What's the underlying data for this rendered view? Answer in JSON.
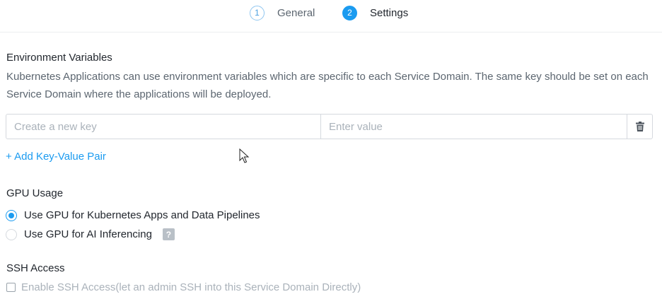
{
  "stepper": {
    "steps": [
      {
        "number": "1",
        "label": "General",
        "state": "inactive"
      },
      {
        "number": "2",
        "label": "Settings",
        "state": "active"
      }
    ]
  },
  "env": {
    "title": "Environment Variables",
    "description": "Kubernetes Applications can use environment variables which are specific to each Service Domain. The same key should be set on each Service Domain where the applications will be deployed.",
    "key_placeholder": "Create a new key",
    "value_placeholder": "Enter value",
    "key_value": "",
    "value_value": "",
    "delete_icon": "trash-icon",
    "add_label": "+ Add Key-Value Pair"
  },
  "gpu": {
    "title": "GPU Usage",
    "options": [
      {
        "label": "Use GPU for Kubernetes Apps and Data Pipelines",
        "checked": true
      },
      {
        "label": "Use GPU for AI Inferencing",
        "checked": false
      }
    ],
    "help_label": "?"
  },
  "ssh": {
    "title": "SSH Access",
    "checkbox_label": "Enable SSH Access(let an admin SSH into this Service Domain Directly)",
    "checked": false
  },
  "colors": {
    "accent": "#1b9bf0",
    "text": "#22272e",
    "muted": "#5c6670",
    "placeholder": "#aab2ba"
  }
}
